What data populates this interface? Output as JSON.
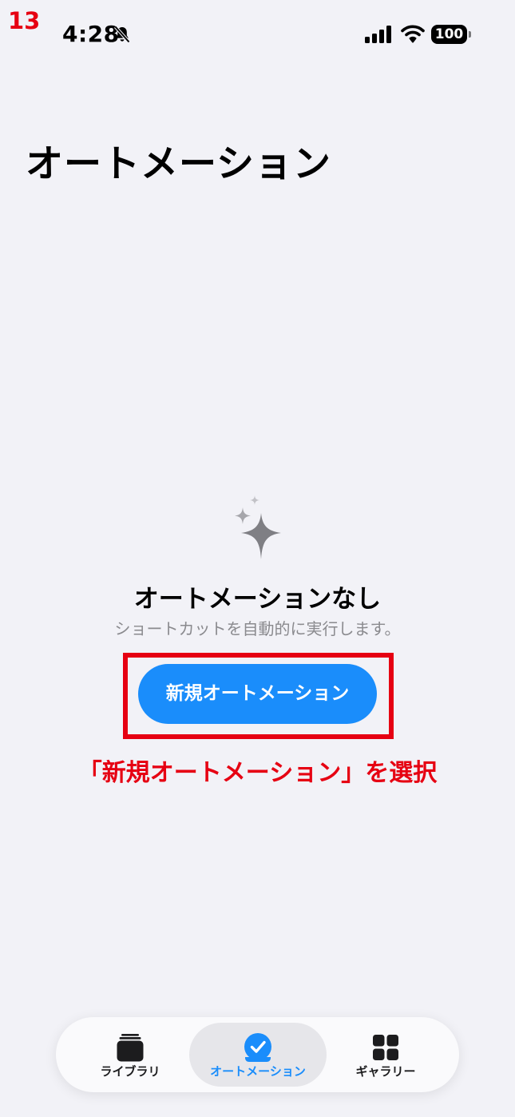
{
  "step_number": "13",
  "status_bar": {
    "time": "4:28",
    "battery_level": "100",
    "icons": [
      "bell-slash-icon",
      "cellular-signal-icon",
      "wifi-icon",
      "battery-icon"
    ]
  },
  "header": {
    "title": "オートメーション"
  },
  "empty_state": {
    "icon": "sparkles-icon",
    "title": "オートメーションなし",
    "subtitle": "ショートカットを自動的に実行します。",
    "button_label": "新規オートメーション"
  },
  "annotation": {
    "instruction": "「新規オートメーション」を選択",
    "color": "#e60012"
  },
  "tab_bar": {
    "tabs": [
      {
        "label": "ライブラリ",
        "icon": "library-stack-icon",
        "active": false
      },
      {
        "label": "オートメーション",
        "icon": "automation-check-icon",
        "active": true
      },
      {
        "label": "ギャラリー",
        "icon": "gallery-grid-icon",
        "active": false
      }
    ]
  },
  "colors": {
    "background": "#f2f2f7",
    "accent": "#1a8dfb",
    "secondary_text": "#8a8a8e"
  }
}
